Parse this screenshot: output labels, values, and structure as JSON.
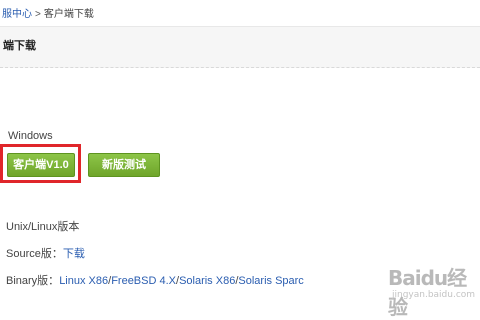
{
  "breadcrumb": {
    "home_partial": "服中心",
    "separator": ">",
    "current": "客户端下载"
  },
  "section": {
    "title": "端下载"
  },
  "windows": {
    "label": "Windows",
    "client_button": "客户端V1.0",
    "beta_button": "新版测试"
  },
  "unix": {
    "label": "Unix/Linux版本"
  },
  "source": {
    "label": "Source版：",
    "link": "下载"
  },
  "binary": {
    "label": "Binary版：",
    "links": [
      "Linux X86",
      "FreeBSD 4.X",
      "Solaris X86",
      "Solaris Sparc"
    ],
    "separator": "/"
  },
  "watermark": {
    "main": "Baidu经验",
    "sub": "jingyan.baidu.com"
  },
  "colors": {
    "button_green": "#7bb236",
    "highlight_red": "#e0262a",
    "link_blue": "#2a5db0"
  }
}
